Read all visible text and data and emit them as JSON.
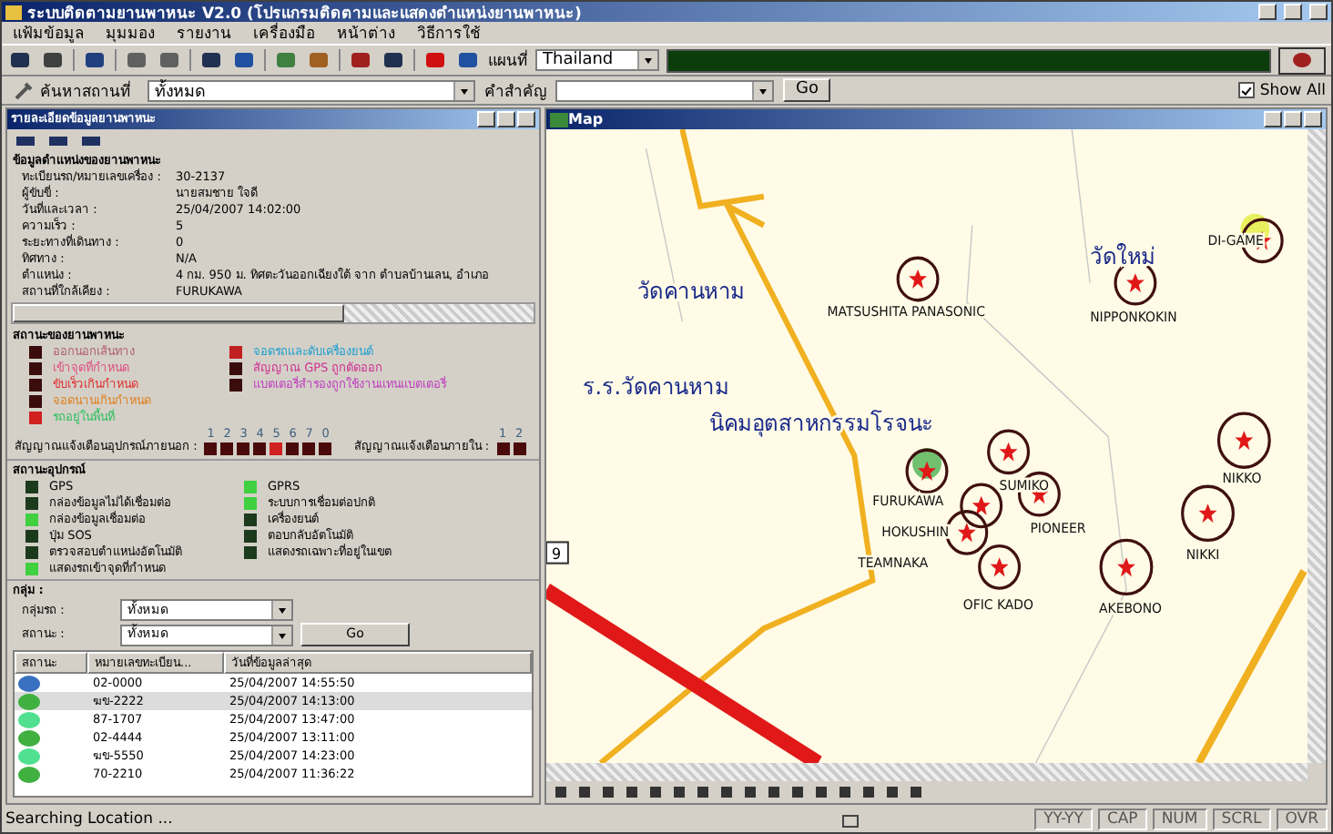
{
  "window": {
    "title": "ระบบติดตามยานพาหนะ V2.0 (โปรแกรมติดตามและแสดงตำแหน่งยานพาหนะ)"
  },
  "menu": [
    "แฟ้มข้อมูล",
    "มุมมอง",
    "รายงาน",
    "เครื่องมือ",
    "หน้าต่าง",
    "วิธีการใช้"
  ],
  "toolbar": {
    "map_label": "แผนที่",
    "map_value": "Thailand"
  },
  "search_bar": {
    "button": "ค้นหาสถานที่",
    "category": "ทั้งหมด",
    "keyword_label": "คำสำคัญ",
    "go": "Go",
    "show_all": {
      "label": "Show All",
      "checked": true
    }
  },
  "info_panel": {
    "title": "รายละเอียดข้อมูลยานพาหนะ",
    "position_section": {
      "title": "ข้อมูลตำแหน่งของยานพาหนะ",
      "rows": [
        {
          "label": "ทะเบียนรถ/หมายเลขเครื่อง :",
          "value": "30-2137"
        },
        {
          "label": "ผู้ขับขี่ :",
          "value": "นายสมชาย ใจดี"
        },
        {
          "label": "วันที่และเวลา :",
          "value": "25/04/2007 14:02:00"
        },
        {
          "label": "ความเร็ว :",
          "value": "5"
        },
        {
          "label": "ระยะทางที่เดินทาง :",
          "value": "0"
        },
        {
          "label": "ทิศทาง :",
          "value": "N/A"
        },
        {
          "label": "ตำแหน่ง :",
          "value": "4 กม. 950 ม. ทิศตะวันออกเฉียงใต้ จาก ตำบลบ้านเลน, อำเภอ"
        },
        {
          "label": "สถานที่ใกล้เคียง :",
          "value": "FURUKAWA"
        }
      ]
    },
    "status_section": {
      "title": "สถานะของยานพาหนะ",
      "items": [
        {
          "label": "ออกนอกเส้นทาง",
          "color": "#b06070",
          "square": {
            "color": "#3a0c0c"
          }
        },
        {
          "label": "เข้าจุดที่กำหนด",
          "color": "#e05080",
          "square": {
            "color": "#3a0c0c"
          }
        },
        {
          "label": "ขับเร็วเกินกำหนด",
          "color": "#e03030",
          "square": {
            "color": "#3a0c0c"
          }
        },
        {
          "label": "จอดนานเกินกำหนด",
          "color": "#e08020",
          "square": {
            "color": "#3a0c0c"
          }
        },
        {
          "label": "รถอยู่ในพื้นที่",
          "color": "#30c060",
          "square": {
            "color": "#d02020"
          }
        },
        {
          "label": "จอดรถและดับเครื่องยนต์",
          "color": "#20a0d0",
          "square": {
            "color": "#c02020"
          }
        },
        {
          "label": "สัญญาณ GPS ถูกตัดออก",
          "color": "#d03090",
          "square": {
            "color": "#3a0c0c"
          }
        },
        {
          "label": "แบตเตอรี่สำรองถูกใช้งานแทนแบตเตอรี่",
          "color": "#c040c0",
          "square": {
            "color": "#3a0c0c"
          }
        }
      ],
      "alarm_label": "สัญญาณแจ้งเตือนอุปกรณ์ภายนอก :",
      "alarm_digits": [
        "1",
        "2",
        "3",
        "4",
        "5",
        "6",
        "7",
        "0"
      ],
      "alarms": [
        {
          "on": false
        },
        {
          "on": false
        },
        {
          "on": false
        },
        {
          "on": false
        },
        {
          "on": true
        },
        {
          "on": false
        },
        {
          "on": false
        },
        {
          "on": false
        }
      ],
      "input_label": "สัญญาณแจ้งเตือนภายใน :",
      "input_digits": [
        "1",
        "2"
      ],
      "inputs": [
        {
          "on": false
        },
        {
          "on": false
        }
      ]
    },
    "device_section": {
      "title": "สถานะอุปกรณ์",
      "items": [
        {
          "label": "GPS",
          "on": false
        },
        {
          "label": "GPRS",
          "on": true
        },
        {
          "label": "กล่องข้อมูลไม่ได้เชื่อมต่อ",
          "on": false
        },
        {
          "label": "ระบบการเชื่อมต่อปกติ",
          "on": true
        },
        {
          "label": "กล่องข้อมูลเชื่อมต่อ",
          "on": true
        },
        {
          "label": "เครื่องยนต์",
          "on": false
        },
        {
          "label": "ปุ่ม SOS",
          "on": false
        },
        {
          "label": "ตอบกลับอัตโนมัติ",
          "on": false
        },
        {
          "label": "ตรวจสอบตำแหน่งอัตโนมัติ",
          "on": false
        },
        {
          "label": "แสดงรถเฉพาะที่อยู่ในเขต",
          "on": false
        },
        {
          "label": "แสดงรถเข้าจุดที่กำหนด",
          "on": true
        }
      ]
    },
    "filter": {
      "title": "กลุ่ม :",
      "group_label": "กลุ่มรถ :",
      "group_value": "ทั้งหมด",
      "status_label": "สถานะ :",
      "status_value": "ทั้งหมด",
      "go": "Go"
    },
    "table": {
      "columns": [
        "สถานะ",
        "หมายเลขทะเบียน...",
        "วันที่ข้อมูลล่าสุด"
      ],
      "rows": [
        {
          "color": "#3a70c0",
          "plate": "02-0000",
          "time": "25/04/2007 14:55:50",
          "selected": false
        },
        {
          "color": "#40b040",
          "plate": "ฆข-2222",
          "time": "25/04/2007 14:13:00",
          "selected": true
        },
        {
          "color": "#50e090",
          "plate": "87-1707",
          "time": "25/04/2007 13:47:00",
          "selected": false
        },
        {
          "color": "#40b040",
          "plate": "02-4444",
          "time": "25/04/2007 13:11:00",
          "selected": false
        },
        {
          "color": "#50e090",
          "plate": "ฆข-5550",
          "time": "25/04/2007 14:23:00",
          "selected": false
        },
        {
          "color": "#40b040",
          "plate": "70-2210",
          "time": "25/04/2007 11:36:22",
          "selected": false
        }
      ]
    }
  },
  "map": {
    "title": "Map",
    "places": [
      "วัดคานหาม",
      "ร.ร.วัดคานหาม",
      "นิคมอุตสาหกรรมโรจนะ",
      "วัดใหม่"
    ],
    "markers": [
      {
        "label": "MATSUSHITA PANASONIC",
        "kind": "site"
      },
      {
        "label": "NIPPONKOKIN",
        "kind": "site"
      },
      {
        "label": "FURUKAWA",
        "kind": "vehicle"
      },
      {
        "label": "SUMIKO",
        "kind": "site"
      },
      {
        "label": "HOKUSHIN",
        "kind": "site"
      },
      {
        "label": "PIONEER",
        "kind": "site"
      },
      {
        "label": "TEAMNAKA",
        "kind": "site"
      },
      {
        "label": "OFIC KADO",
        "kind": "site"
      },
      {
        "label": "NIKKO",
        "kind": "site"
      },
      {
        "label": "NIKKI",
        "kind": "site"
      },
      {
        "label": "AKEBONO",
        "kind": "site"
      },
      {
        "label": "DI-GAME",
        "kind": "target"
      }
    ],
    "road_sign": "9"
  },
  "status_bar": {
    "message": "Searching Location ...",
    "coords": "YY-YY",
    "indicators": [
      "CAP",
      "NUM",
      "SCRL",
      "OVR"
    ]
  }
}
